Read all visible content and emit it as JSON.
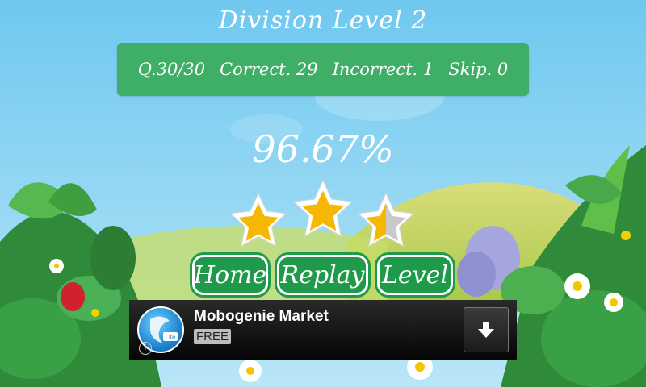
{
  "game": {
    "title": "Division Level 2",
    "stats": {
      "question": "Q.30/30",
      "correct": "Correct. 29",
      "incorrect": "Incorrect. 1",
      "skip": "Skip. 0"
    },
    "score_percent": "96.67%",
    "stars_earned": 2.5,
    "stars_total": 3,
    "buttons": {
      "home": "Home",
      "replay": "Replay",
      "level": "Level"
    }
  },
  "ad": {
    "app_name": "Mobogenie Market",
    "price": "FREE",
    "icon": "mobogenie-lite-icon",
    "badge": "Lite",
    "action_icon": "download-arrow-icon"
  },
  "colors": {
    "sky": "#7ecff0",
    "panel": "#3fae66",
    "button": "#1f9a4a",
    "star": "#f5b800"
  }
}
